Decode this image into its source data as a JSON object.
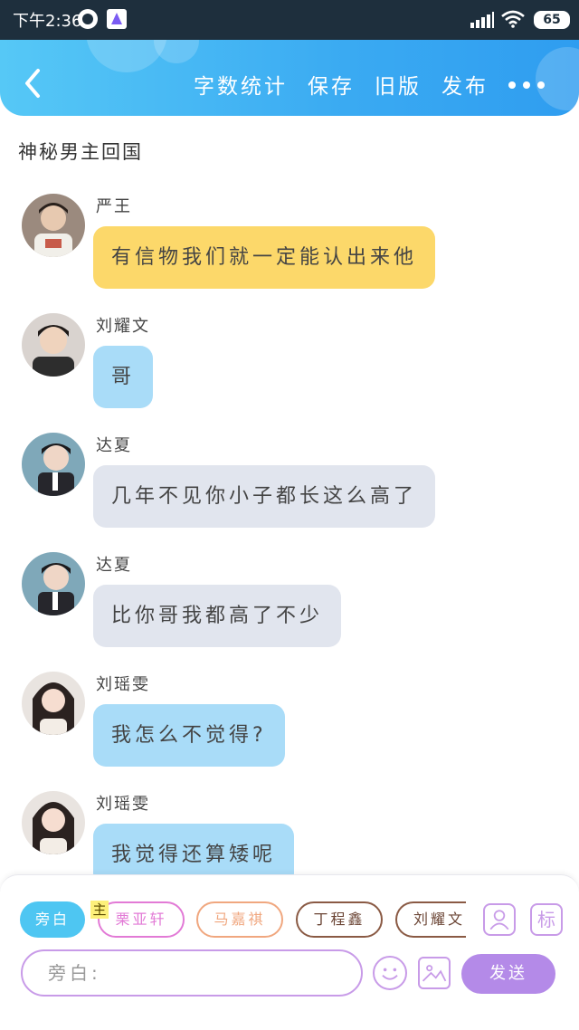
{
  "status_bar": {
    "time": "下午2:36",
    "battery": "65"
  },
  "header": {
    "actions": [
      "字数统计",
      "保存",
      "旧版",
      "发布"
    ]
  },
  "story": {
    "title": "神秘男主回国"
  },
  "messages": [
    {
      "sender": "严王",
      "text": "有信物我们就一定能认出来他",
      "color": "#fcd86a"
    },
    {
      "sender": "刘耀文",
      "text": "哥",
      "color": "#a9dcf8"
    },
    {
      "sender": "达夏",
      "text": "几年不见你小子都长这么高了",
      "color": "#e1e5ee"
    },
    {
      "sender": "达夏",
      "text": "比你哥我都高了不少",
      "color": "#e1e5ee"
    },
    {
      "sender": "刘瑶雯",
      "text": "我怎么不觉得?",
      "color": "#a9dcf8"
    },
    {
      "sender": "刘瑶雯",
      "text": "我觉得还算矮呢",
      "color": "#a9dcf8"
    }
  ],
  "composer": {
    "characters": [
      "旁白",
      "栗亚轩",
      "马嘉祺",
      "丁程鑫",
      "刘耀文"
    ],
    "main_tag": "主",
    "tag_button": "标",
    "input_placeholder": "旁白:",
    "send_label": "发送"
  },
  "colors": {
    "header_gradient_start": "#56c8f6",
    "header_gradient_end": "#2f9df0",
    "accent_purple": "#b48ae8"
  }
}
